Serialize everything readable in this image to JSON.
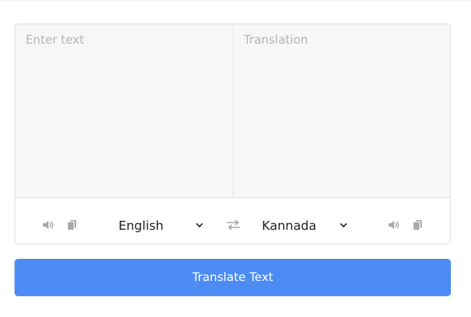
{
  "source": {
    "placeholder": "Enter text",
    "language": "English"
  },
  "target": {
    "placeholder": "Translation",
    "language": "Kannada"
  },
  "icons": {
    "source_speak": "volume-icon",
    "source_copy": "copy-icon",
    "swap": "exchange-icon",
    "target_speak": "volume-icon",
    "target_copy": "copy-icon"
  },
  "translate_button": {
    "label": "Translate Text"
  },
  "colors": {
    "accent": "#4d8cf5",
    "panel_bg": "#f7f7f7",
    "icon_gray": "#a9a9a9",
    "placeholder_gray": "#b4b4b4"
  }
}
